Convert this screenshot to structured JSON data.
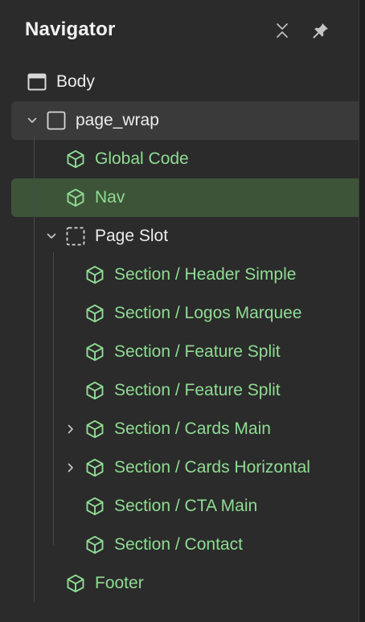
{
  "navigator": {
    "title": "Navigator",
    "collapse_icon": "collapse-all-icon",
    "pin_icon": "pin-icon"
  },
  "tree": [
    {
      "label": "Body",
      "icon": "body-icon",
      "depth": 0,
      "caret": null,
      "color": "white"
    },
    {
      "label": "page_wrap",
      "icon": "div-block-icon",
      "depth": 1,
      "caret": "expanded",
      "color": "white",
      "state": "hover"
    },
    {
      "label": "Global Code",
      "icon": "component-icon",
      "depth": 2,
      "caret": null,
      "color": "green"
    },
    {
      "label": "Nav",
      "icon": "component-icon",
      "depth": 2,
      "caret": null,
      "color": "green",
      "state": "selected"
    },
    {
      "label": "Page Slot",
      "icon": "slot-icon",
      "depth": 2,
      "caret": "expanded",
      "color": "white"
    },
    {
      "label": "Section / Header Simple",
      "icon": "component-icon",
      "depth": 3,
      "caret": null,
      "color": "green"
    },
    {
      "label": "Section / Logos Marquee",
      "icon": "component-icon",
      "depth": 3,
      "caret": null,
      "color": "green"
    },
    {
      "label": "Section / Feature Split",
      "icon": "component-icon",
      "depth": 3,
      "caret": null,
      "color": "green"
    },
    {
      "label": "Section / Feature Split",
      "icon": "component-icon",
      "depth": 3,
      "caret": null,
      "color": "green"
    },
    {
      "label": "Section / Cards Main",
      "icon": "component-icon",
      "depth": 3,
      "caret": "collapsed",
      "color": "green"
    },
    {
      "label": "Section / Cards Horizontal",
      "icon": "component-icon",
      "depth": 3,
      "caret": "collapsed",
      "color": "green"
    },
    {
      "label": "Section / CTA Main",
      "icon": "component-icon",
      "depth": 3,
      "caret": null,
      "color": "green"
    },
    {
      "label": "Section / Contact",
      "icon": "component-icon",
      "depth": 3,
      "caret": null,
      "color": "green"
    },
    {
      "label": "Footer",
      "icon": "component-icon",
      "depth": 2,
      "caret": null,
      "color": "green"
    }
  ],
  "colors": {
    "panel_bg": "#2b2b2b",
    "component_green": "#8fdc93",
    "selected_bg": "#3d5439",
    "hover_bg": "#3a3a3a"
  }
}
